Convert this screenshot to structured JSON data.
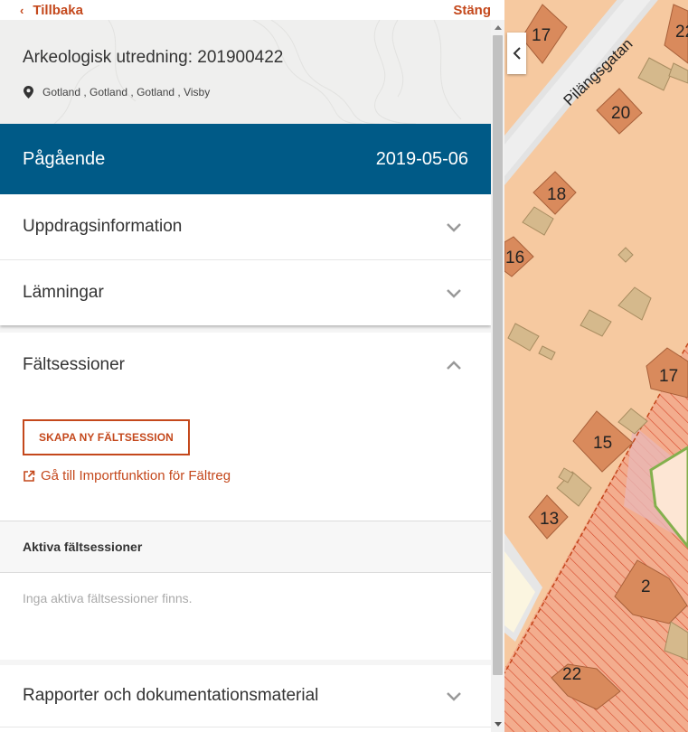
{
  "topbar": {
    "back_label": "Tillbaka",
    "close_label": "Stäng"
  },
  "header": {
    "title": "Arkeologisk utredning: 201900422",
    "location": "Gotland , Gotland , Gotland , Visby"
  },
  "status": {
    "label": "Pågående",
    "date": "2019-05-06"
  },
  "sections": {
    "uppdrag": "Uppdragsinformation",
    "lamningar": "Lämningar",
    "faltsessioner": "Fältsessioner",
    "rapporter": "Rapporter och dokumentationsmaterial"
  },
  "faltsessioner": {
    "create_button": "SKAPA NY FÄLTSESSION",
    "import_link": "Gå till Importfunktion för Fältreg",
    "active_header": "Aktiva fältsessioner",
    "empty_text": "Inga aktiva fältsessioner finns."
  },
  "map": {
    "street": "Pilängsgatan",
    "labels": [
      "17",
      "22",
      "20",
      "18",
      "16",
      "17",
      "15",
      "13",
      "2",
      "22"
    ]
  },
  "colors": {
    "accent": "#c4481c",
    "status_bar": "#005a87",
    "map_plot": "#f6c9a0",
    "map_building": "#d98a5c"
  }
}
